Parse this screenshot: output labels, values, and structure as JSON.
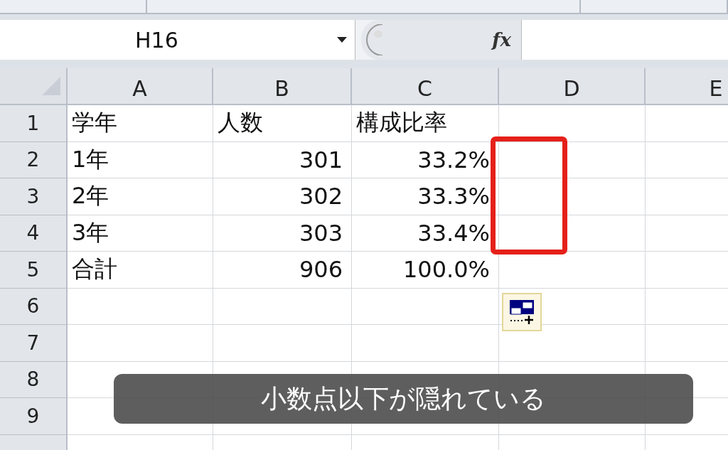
{
  "name_box": "H16",
  "formula_button": "fx",
  "columns": [
    "A",
    "B",
    "C",
    "D",
    "E"
  ],
  "rows": [
    {
      "number": "1",
      "highlighted": false,
      "cells": [
        {
          "text": "学年",
          "kind": "text"
        },
        {
          "text": "人数",
          "kind": "text"
        },
        {
          "text": "構成比率",
          "kind": "text"
        }
      ]
    },
    {
      "number": "2",
      "highlighted": true,
      "cells": [
        {
          "text": "1年",
          "kind": "text"
        },
        {
          "text": "301",
          "kind": "number"
        },
        {
          "text": "33.2%",
          "kind": "number"
        }
      ]
    },
    {
      "number": "3",
      "highlighted": true,
      "cells": [
        {
          "text": "2年",
          "kind": "text"
        },
        {
          "text": "302",
          "kind": "number"
        },
        {
          "text": "33.3%",
          "kind": "number"
        }
      ]
    },
    {
      "number": "4",
      "highlighted": true,
      "cells": [
        {
          "text": "3年",
          "kind": "text"
        },
        {
          "text": "303",
          "kind": "number"
        },
        {
          "text": "33.4%",
          "kind": "number"
        }
      ]
    },
    {
      "number": "5",
      "highlighted": false,
      "cells": [
        {
          "text": "合計",
          "kind": "text"
        },
        {
          "text": "906",
          "kind": "number"
        },
        {
          "text": "100.0%",
          "kind": "number"
        }
      ]
    },
    {
      "number": "6",
      "highlighted": false,
      "paste_options": true
    },
    {
      "number": "7",
      "highlighted": false
    },
    {
      "number": "8",
      "highlighted": false
    },
    {
      "number": "9",
      "highlighted": false
    }
  ],
  "caption": "小数点以下が隠れている"
}
